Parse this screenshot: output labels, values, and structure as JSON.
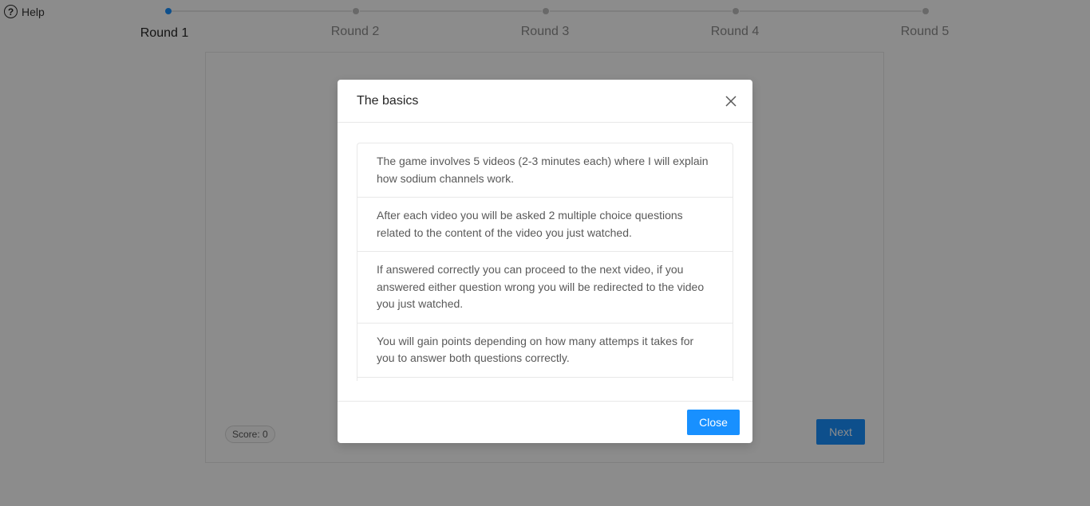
{
  "help": {
    "icon": "question-circle-icon",
    "label": "Help"
  },
  "steps": {
    "accent": "#1890ff",
    "items": [
      {
        "label": "Round 1",
        "active": true
      },
      {
        "label": "Round 2",
        "active": false
      },
      {
        "label": "Round 3",
        "active": false
      },
      {
        "label": "Round 4",
        "active": false
      },
      {
        "label": "Round 5",
        "active": false
      }
    ]
  },
  "card": {
    "score_label": "Score: 0",
    "next_label": "Next"
  },
  "modal": {
    "title": "The basics",
    "close_icon": "close-icon",
    "items": [
      "The game involves 5 videos (2-3 minutes each) where I will explain how sodium channels work.",
      "After each video you will be asked 2 multiple choice questions related to the content of the video you just watched.",
      "If answered correctly you can proceed to the next video, if you answered either question wrong you will be redirected to the video you just watched.",
      "You will gain points depending on how many attemps it takes for you to answer both questions correctly."
    ],
    "close_button_label": "Close"
  }
}
